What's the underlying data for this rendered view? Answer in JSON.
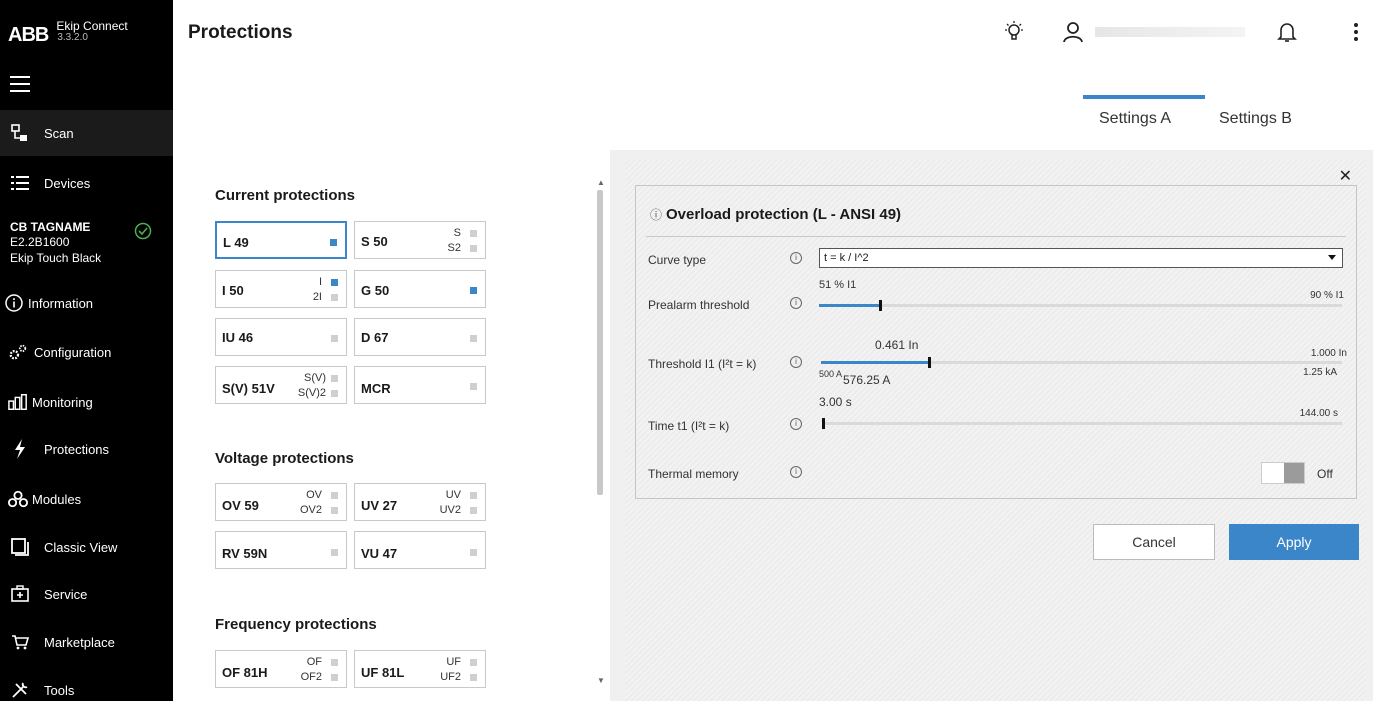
{
  "app": {
    "brand": "ABB",
    "name": "Ekip Connect",
    "version": "3.3.2.0"
  },
  "sidebar": {
    "items": [
      {
        "label": "Scan",
        "icon": "network-scan-icon"
      },
      {
        "label": "Devices",
        "icon": "list-icon"
      },
      {
        "label": "Information",
        "icon": "info-circle-icon"
      },
      {
        "label": "Configuration",
        "icon": "gears-icon"
      },
      {
        "label": "Monitoring",
        "icon": "bar-chart-icon"
      },
      {
        "label": "Protections",
        "icon": "lightning-icon"
      },
      {
        "label": "Modules",
        "icon": "modules-icon"
      },
      {
        "label": "Classic View",
        "icon": "window-icon"
      },
      {
        "label": "Service",
        "icon": "toolbox-icon"
      },
      {
        "label": "Marketplace",
        "icon": "cart-icon"
      },
      {
        "label": "Tools",
        "icon": "tools-icon"
      }
    ],
    "device": {
      "name": "CB TAGNAME",
      "model": "E2.2B1600",
      "unit": "Ekip Touch Black"
    }
  },
  "header": {
    "title": "Protections",
    "tabs": [
      {
        "label": "Settings A",
        "active": true
      },
      {
        "label": "Settings B",
        "active": false
      }
    ]
  },
  "protections": {
    "current_title": "Current protections",
    "voltage_title": "Voltage protections",
    "frequency_title": "Frequency protections",
    "current": [
      {
        "label": "L 49",
        "subs": [],
        "state": "on"
      },
      {
        "label": "S 50",
        "subs": [
          "S",
          "S2"
        ],
        "state": "off"
      },
      {
        "label": "I 50",
        "subs": [
          "I",
          "2I"
        ],
        "state": "on"
      },
      {
        "label": "G 50",
        "subs": [],
        "state": "on"
      },
      {
        "label": "IU 46",
        "subs": [],
        "state": "off"
      },
      {
        "label": "D 67",
        "subs": [],
        "state": "off"
      },
      {
        "label": "S(V) 51V",
        "subs": [
          "S(V)",
          "S(V)2"
        ],
        "state": "off"
      },
      {
        "label": "MCR",
        "subs": [],
        "state": "off"
      }
    ],
    "voltage": [
      {
        "label": "OV 59",
        "subs": [
          "OV",
          "OV2"
        ],
        "state": "off"
      },
      {
        "label": "UV 27",
        "subs": [
          "UV",
          "UV2"
        ],
        "state": "off"
      },
      {
        "label": "RV 59N",
        "subs": [],
        "state": "off"
      },
      {
        "label": "VU 47",
        "subs": [],
        "state": "off"
      }
    ],
    "frequency": [
      {
        "label": "OF 81H",
        "subs": [
          "OF",
          "OF2"
        ],
        "state": "off"
      },
      {
        "label": "UF 81L",
        "subs": [
          "UF",
          "UF2"
        ],
        "state": "off"
      }
    ]
  },
  "overload": {
    "title": "Overload protection (L - ANSI 49)",
    "curve_label": "Curve type",
    "curve_value": "t = k / I^2",
    "prealarm_label": "Prealarm threshold",
    "prealarm_value": "51 % I1",
    "prealarm_max": "90 % I1",
    "prealarm_fraction": 0.02,
    "threshold_label": "Threshold I1 (I²t = k)",
    "threshold_value": "0.461 In",
    "threshold_max": "1.000 In",
    "threshold_min_a": "500 A",
    "threshold_amps": "576.25 A",
    "threshold_max_a": "1.25 kA",
    "threshold_fraction": 0.11,
    "time_label": "Time t1 (I²t = k)",
    "time_value": "3.00 s",
    "time_max": "144.00 s",
    "time_fraction": 0.0,
    "memory_label": "Thermal memory",
    "memory_state": "Off"
  },
  "actions": {
    "cancel": "Cancel",
    "apply": "Apply"
  },
  "colors": {
    "accent": "#3a86c9",
    "sidebar": "#000000"
  }
}
